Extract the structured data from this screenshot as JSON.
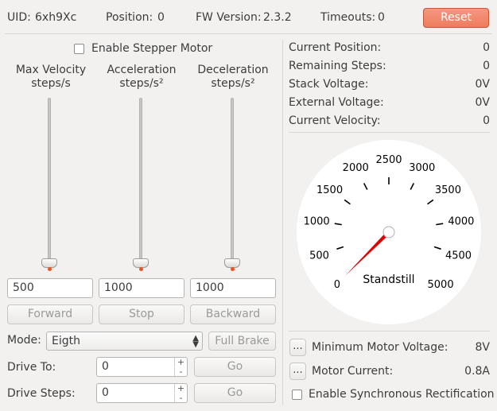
{
  "header": {
    "uid_label": "UID:",
    "uid_value": "6xh9Xc",
    "position_label": "Position:",
    "position_value": "0",
    "fw_label": "FW Version:",
    "fw_value": "2.3.2",
    "timeouts_label": "Timeouts:",
    "timeouts_value": "0",
    "reset_label": "Reset"
  },
  "stepper": {
    "enable_label": "Enable Stepper Motor",
    "enabled": false,
    "sliders": [
      {
        "label_line1": "Max Velocity",
        "label_line2": "steps/s",
        "value": "500",
        "level": 0
      },
      {
        "label_line1": "Acceleration",
        "label_line2": "steps/s²",
        "value": "1000",
        "level": 0
      },
      {
        "label_line1": "Deceleration",
        "label_line2": "steps/s²",
        "value": "1000",
        "level": 0
      }
    ],
    "forward_label": "Forward",
    "stop_label": "Stop",
    "backward_label": "Backward",
    "mode_label": "Mode:",
    "mode_value": "Eigth",
    "full_brake_label": "Full Brake",
    "drive_to_label": "Drive To:",
    "drive_to_value": "0",
    "drive_steps_label": "Drive Steps:",
    "drive_steps_value": "0",
    "go_label": "Go",
    "spin_up": "+",
    "spin_down": "-"
  },
  "status": {
    "rows": [
      {
        "label": "Current Position:",
        "value": "0"
      },
      {
        "label": "Remaining Steps:",
        "value": "0"
      },
      {
        "label": "Stack Voltage:",
        "value": "0V"
      },
      {
        "label": "External Voltage:",
        "value": "0V"
      },
      {
        "label": "Current Velocity:",
        "value": "0"
      }
    ]
  },
  "gauge": {
    "min": 0,
    "max": 5000,
    "value": 0,
    "tick_labels": [
      "0",
      "500",
      "1000",
      "1500",
      "2000",
      "2500",
      "3000",
      "3500",
      "4000",
      "4500",
      "5000"
    ],
    "state_label": "Standstill",
    "needle_color": "#e00000",
    "hub_color": "#ffffff"
  },
  "settings": {
    "ellipsis_label": "...",
    "min_voltage_label": "Minimum Motor Voltage:",
    "min_voltage_value": "8V",
    "motor_current_label": "Motor Current:",
    "motor_current_value": "0.8A",
    "sync_rect_label": "Enable Synchronous Rectification",
    "sync_rect_enabled": false
  },
  "colors": {
    "accent": "#ee7c5e",
    "slider_dot": "#e95420"
  }
}
